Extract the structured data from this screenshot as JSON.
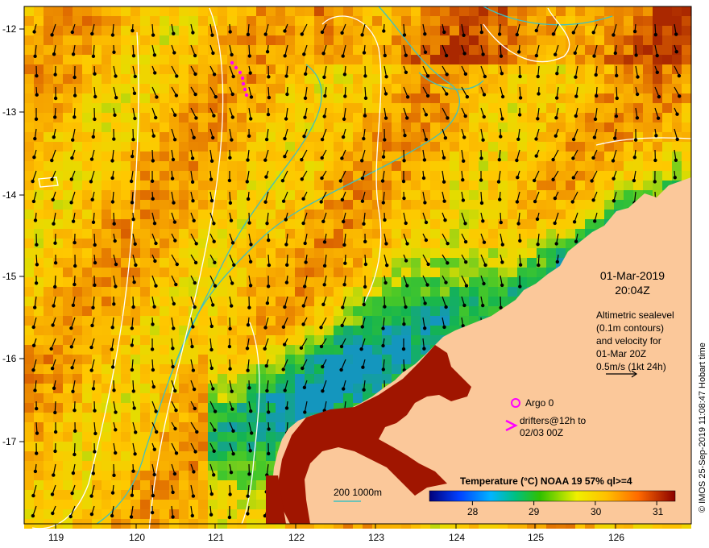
{
  "date": {
    "line1": "01-Mar-2019",
    "line2": "20:04Z"
  },
  "altimetry": {
    "lines": [
      "Altimetric sealevel",
      "(0.1m contours)",
      "and velocity for",
      "01-Mar 20Z",
      "0.5m/s (1kt 24h)"
    ]
  },
  "legend": {
    "argo": "Argo 0",
    "drifters_1": "drifters@12h to",
    "drifters_2": "02/03 00Z",
    "depth": "200  1000m"
  },
  "colorbar": {
    "title": "Temperature (°C) NOAA 19 57% ql>=4",
    "ticks": [
      "28",
      "29",
      "30",
      "31"
    ],
    "min": 27.3,
    "max": 31.3
  },
  "credit": "© IMOS 25-Sep-2019 11:08:47 Hobart time",
  "axes": {
    "x_ticks": [
      "119",
      "120",
      "121",
      "122",
      "123",
      "124",
      "125",
      "126"
    ],
    "y_ticks": [
      "-12",
      "-13",
      "-14",
      "-15",
      "-16",
      "-17"
    ],
    "lon_range": [
      118.6,
      127.0
    ],
    "lat_range": [
      -11.75,
      -17.95
    ]
  },
  "colors": {
    "land": "#fbc89a",
    "coast_water": "#a01500",
    "contour_depth": "#3fc0c0",
    "contour_sealevel": "#ffffff",
    "drifter": "#ff00ff",
    "arrow": "#000000"
  }
}
